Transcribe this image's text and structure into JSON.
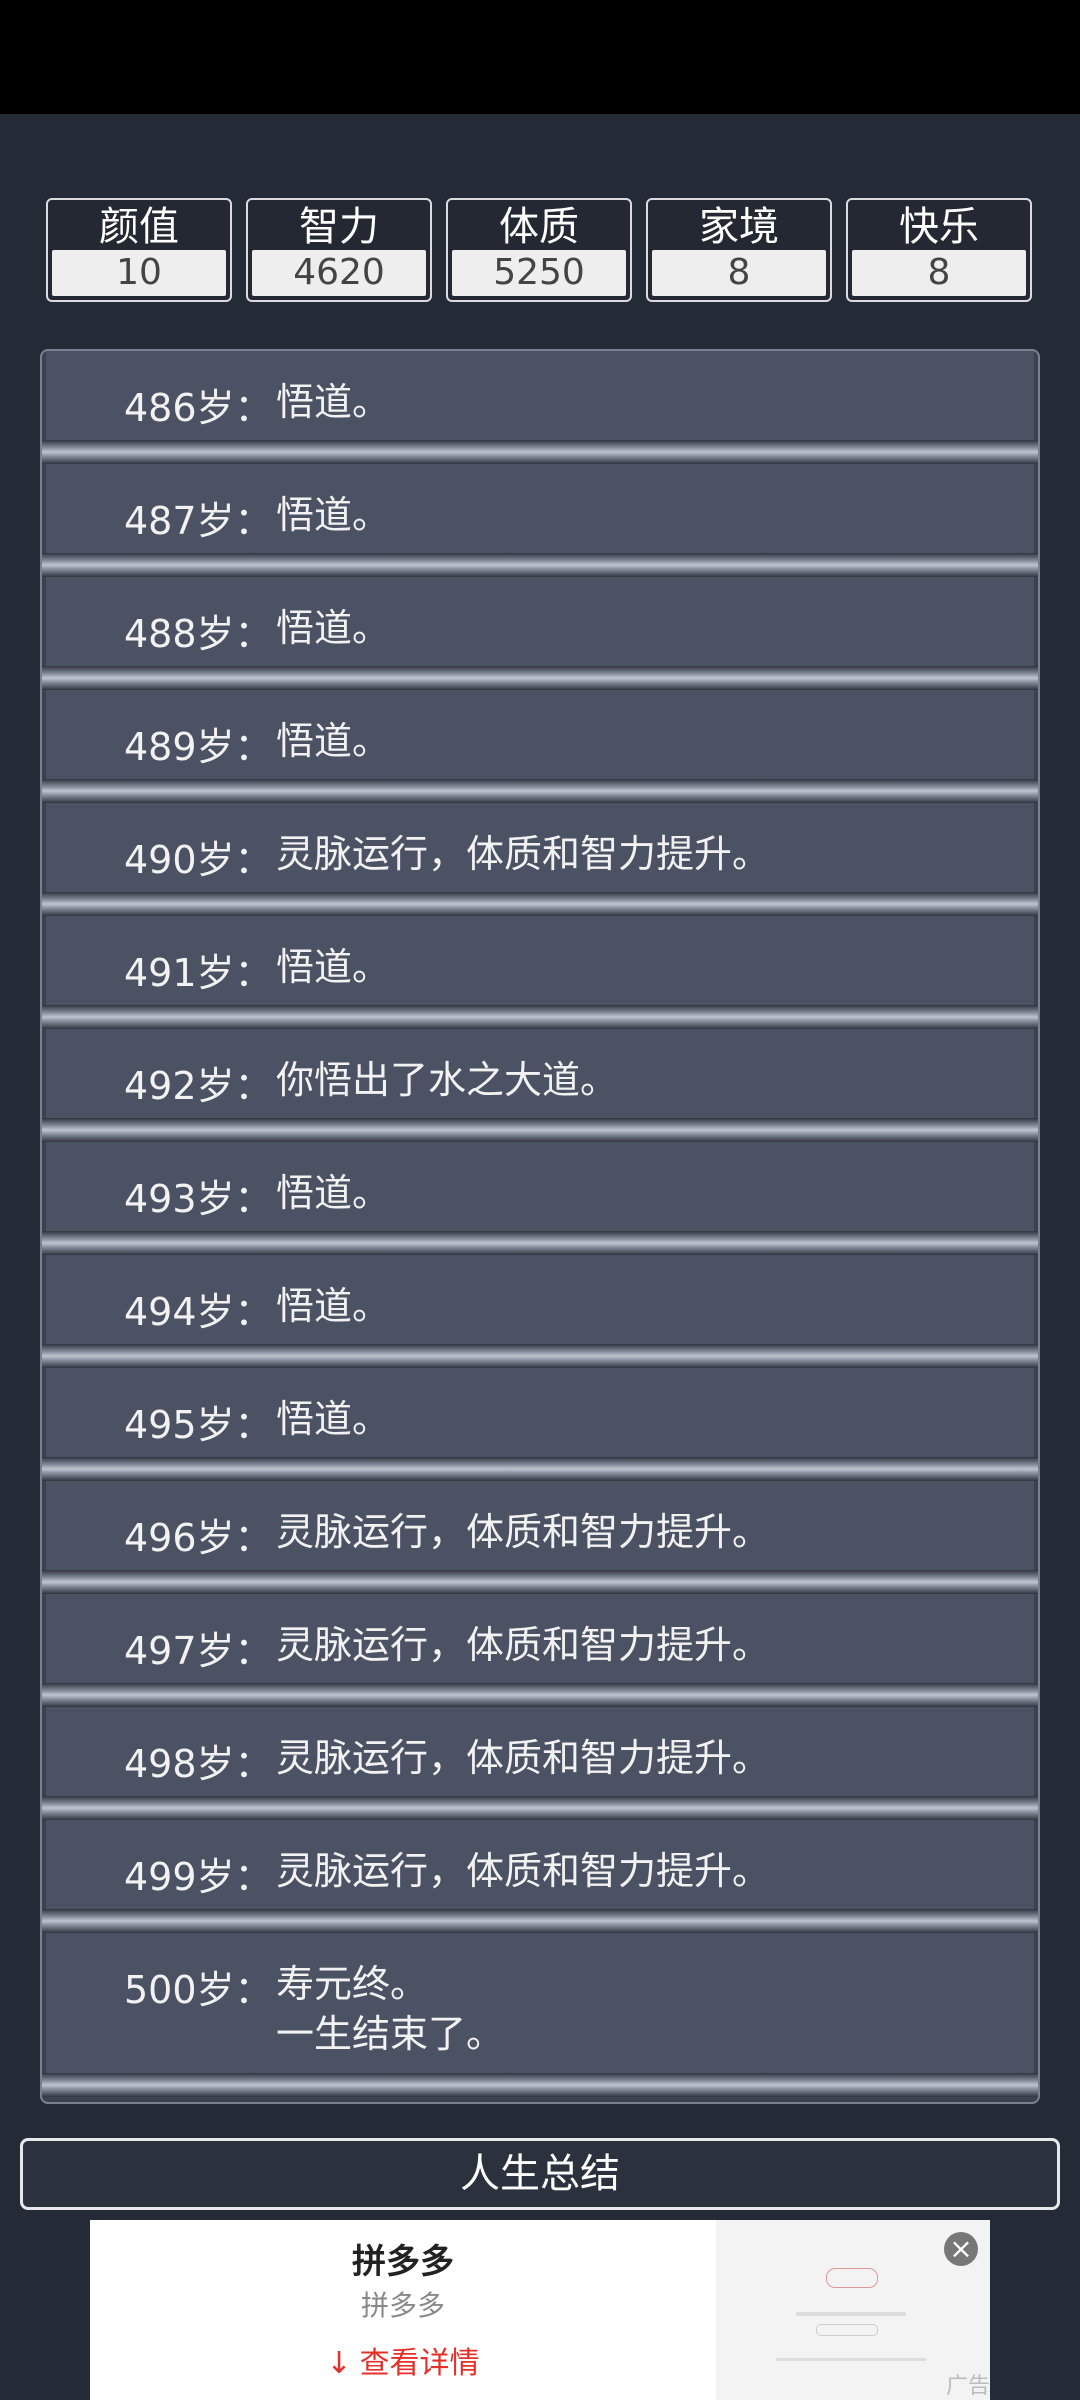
{
  "stats": [
    {
      "label": "颜值",
      "value": "10"
    },
    {
      "label": "智力",
      "value": "4620"
    },
    {
      "label": "体质",
      "value": "5250"
    },
    {
      "label": "家境",
      "value": "8"
    },
    {
      "label": "快乐",
      "value": "8"
    }
  ],
  "log": [
    {
      "age": "486岁：",
      "event": "悟道。"
    },
    {
      "age": "487岁：",
      "event": "悟道。"
    },
    {
      "age": "488岁：",
      "event": "悟道。"
    },
    {
      "age": "489岁：",
      "event": "悟道。"
    },
    {
      "age": "490岁：",
      "event": "灵脉运行，体质和智力提升。"
    },
    {
      "age": "491岁：",
      "event": "悟道。"
    },
    {
      "age": "492岁：",
      "event": "你悟出了水之大道。"
    },
    {
      "age": "493岁：",
      "event": "悟道。"
    },
    {
      "age": "494岁：",
      "event": "悟道。"
    },
    {
      "age": "495岁：",
      "event": "悟道。"
    },
    {
      "age": "496岁：",
      "event": "灵脉运行，体质和智力提升。"
    },
    {
      "age": "497岁：",
      "event": "灵脉运行，体质和智力提升。"
    },
    {
      "age": "498岁：",
      "event": "灵脉运行，体质和智力提升。"
    },
    {
      "age": "499岁：",
      "event": "灵脉运行，体质和智力提升。"
    },
    {
      "age": "500岁：",
      "event": "寿元终。",
      "event2": "一生结束了。"
    }
  ],
  "summary_button": "人生总结",
  "ad": {
    "title": "拼多多",
    "subtitle": "拼多多",
    "cta": "查看详情",
    "close_icon": "close-icon",
    "tag": "广告"
  }
}
